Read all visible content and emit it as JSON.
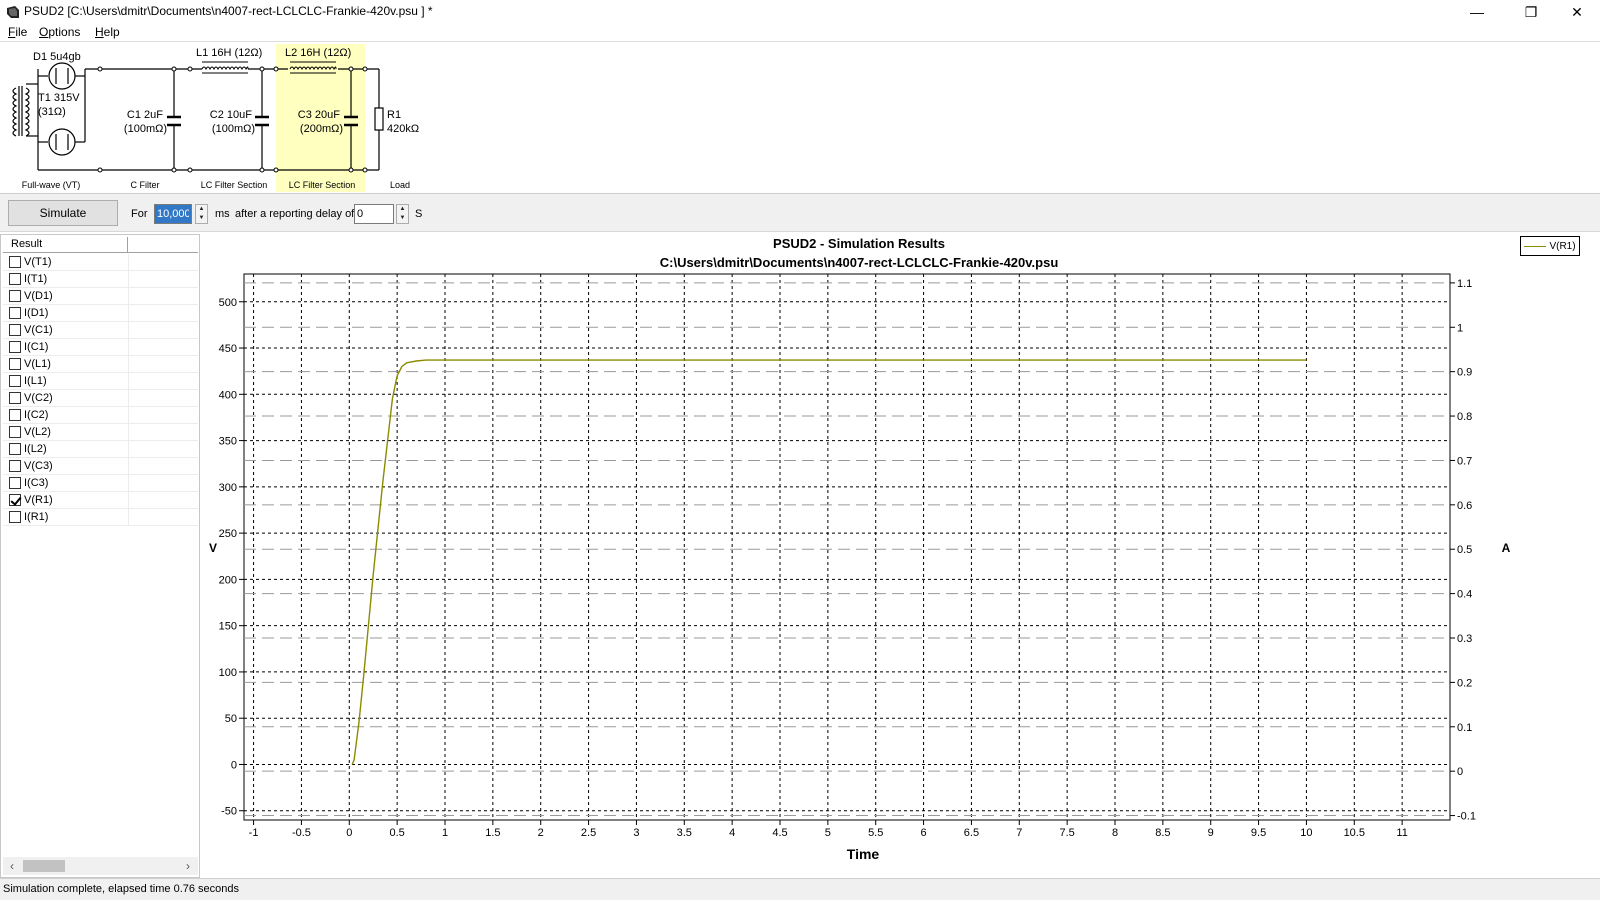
{
  "window": {
    "title": "PSUD2  [C:\\Users\\dmitr\\Documents\\n4007-rect-LCLCLC-Frankie-420v.psu ] *",
    "minimize": "—",
    "restore": "❐",
    "close": "✕"
  },
  "menu": [
    {
      "acc": "F",
      "rest": "ile"
    },
    {
      "acc": "O",
      "rest": "ptions"
    },
    {
      "acc": "H",
      "rest": "elp"
    }
  ],
  "circuit": {
    "d1": "D1 5u4gb",
    "t1_line1": "T1 315V",
    "t1_line2": "(31Ω)",
    "l1": "L1 16H (12Ω)",
    "l2": "L2 16H (12Ω)",
    "c1_line1": "C1 2uF",
    "c1_line2": "(100mΩ)",
    "c2_line1": "C2 10uF",
    "c2_line2": "(100mΩ)",
    "c3_line1": "C3 20uF",
    "c3_line2": "(200mΩ)",
    "r1_line1": "R1",
    "r1_line2": "420kΩ",
    "sections": [
      "Full-wave (VT)",
      "C Filter",
      "LC Filter Section",
      "LC Filter Section",
      "Load"
    ],
    "highlight_color": "#ffffc0"
  },
  "toolbar": {
    "simulate": "Simulate",
    "for_label": "For",
    "duration_value": "10,000",
    "ms_label": "ms",
    "delay_label": "after a reporting delay of",
    "delay_value": "0",
    "s_label": "S"
  },
  "results": {
    "header": "Result",
    "items": [
      {
        "label": "V(T1)",
        "checked": false
      },
      {
        "label": "I(T1)",
        "checked": false
      },
      {
        "label": "V(D1)",
        "checked": false
      },
      {
        "label": "I(D1)",
        "checked": false
      },
      {
        "label": "V(C1)",
        "checked": false
      },
      {
        "label": "I(C1)",
        "checked": false
      },
      {
        "label": "V(L1)",
        "checked": false
      },
      {
        "label": "I(L1)",
        "checked": false
      },
      {
        "label": "V(C2)",
        "checked": false
      },
      {
        "label": "I(C2)",
        "checked": false
      },
      {
        "label": "V(L2)",
        "checked": false
      },
      {
        "label": "I(L2)",
        "checked": false
      },
      {
        "label": "V(C3)",
        "checked": false
      },
      {
        "label": "I(C3)",
        "checked": false
      },
      {
        "label": "V(R1)",
        "checked": true
      },
      {
        "label": "I(R1)",
        "checked": false
      }
    ]
  },
  "chart_data": {
    "type": "line",
    "title": "PSUD2 - Simulation Results",
    "subtitle": "C:\\Users\\dmitr\\Documents\\n4007-rect-LCLCLC-Frankie-420v.psu",
    "xlabel": "Time",
    "ylabel": "V",
    "y2label": "A",
    "xlim": [
      -1.1,
      11.5
    ],
    "ylim": [
      -60,
      530
    ],
    "y2lim": [
      -0.11,
      1.12
    ],
    "x_ticks": [
      "-1",
      "-0.5",
      "0",
      "0.5",
      "1",
      "1.5",
      "2",
      "2.5",
      "3",
      "3.5",
      "4",
      "4.5",
      "5",
      "5.5",
      "6",
      "6.5",
      "7",
      "7.5",
      "8",
      "8.5",
      "9",
      "9.5",
      "10",
      "10.5",
      "11"
    ],
    "y_ticks": [
      "-50",
      "0",
      "50",
      "100",
      "150",
      "200",
      "250",
      "300",
      "350",
      "400",
      "450",
      "500"
    ],
    "y2_ticks": [
      "-0.1",
      "0",
      "0.1",
      "0.2",
      "0.3",
      "0.4",
      "0.5",
      "0.6",
      "0.7",
      "0.8",
      "0.9",
      "1",
      "1.1"
    ],
    "grid": true,
    "legend": "top-right",
    "series": [
      {
        "name": "V(R1)",
        "color": "#8b8b00",
        "x": [
          0.03,
          0.05,
          0.1,
          0.15,
          0.2,
          0.25,
          0.3,
          0.35,
          0.4,
          0.45,
          0.5,
          0.55,
          0.6,
          0.7,
          0.8,
          0.9,
          1.0,
          2,
          4,
          6,
          8,
          10
        ],
        "y": [
          0,
          5,
          45,
          95,
          150,
          205,
          255,
          305,
          350,
          395,
          420,
          430,
          434,
          436,
          437,
          437,
          437,
          437,
          437,
          437,
          437,
          437
        ]
      }
    ]
  },
  "status": {
    "text": "Simulation complete, elapsed time 0.76 seconds"
  }
}
